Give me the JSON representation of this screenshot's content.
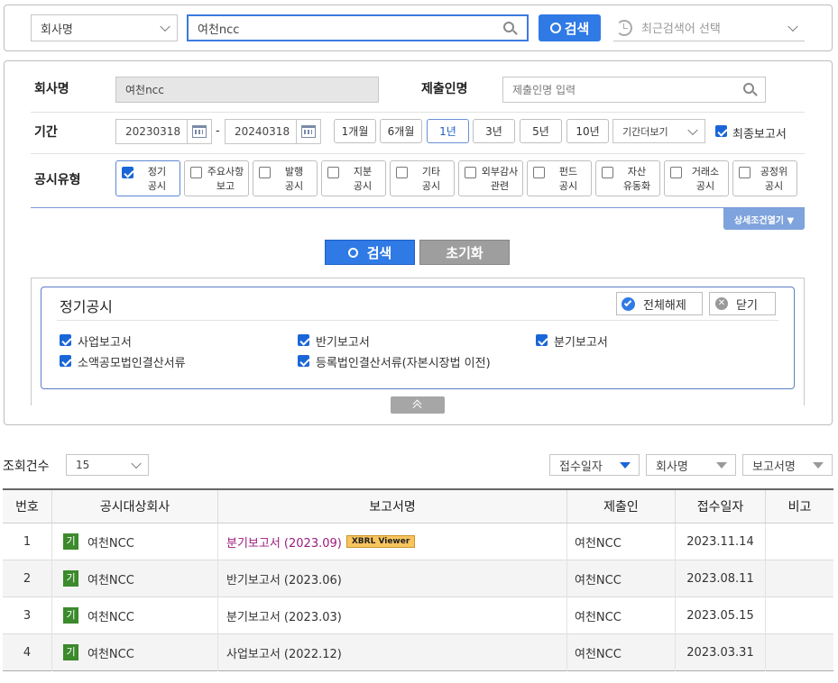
{
  "search": {
    "scope": "회사명",
    "query": "여천ncc",
    "button": "검색",
    "recent_placeholder": "최근검색어 선택"
  },
  "form": {
    "company_label": "회사명",
    "company_value": "여천ncc",
    "submitter_label": "제출인명",
    "submitter_placeholder": "제출인명 입력",
    "period_label": "기간",
    "date_from": "20230318",
    "date_sep": "-",
    "date_to": "20240318",
    "periods": [
      "1개월",
      "6개월",
      "1년",
      "3년",
      "5년",
      "10년"
    ],
    "period_more": "기간더보기",
    "final_report_label": "최종보고서",
    "type_label": "공시유형",
    "types": [
      {
        "line1": "정기",
        "line2": "공시",
        "checked": true
      },
      {
        "line1": "주요사항",
        "line2": "보고",
        "checked": false
      },
      {
        "line1": "발행",
        "line2": "공시",
        "checked": false
      },
      {
        "line1": "지분",
        "line2": "공시",
        "checked": false
      },
      {
        "line1": "기타",
        "line2": "공시",
        "checked": false
      },
      {
        "line1": "외부감사",
        "line2": "관련",
        "checked": false
      },
      {
        "line1": "펀드",
        "line2": "공시",
        "checked": false
      },
      {
        "line1": "자산",
        "line2": "유동화",
        "checked": false
      },
      {
        "line1": "거래소",
        "line2": "공시",
        "checked": false
      },
      {
        "line1": "공정위",
        "line2": "공시",
        "checked": false
      }
    ],
    "detail_toggle": "상세조건열기 ▼",
    "search_button": "검색",
    "reset_button": "초기화"
  },
  "periodic": {
    "title": "정기공시",
    "deselect_all": "전체해제",
    "close": "닫기",
    "items": [
      "사업보고서",
      "반기보고서",
      "분기보고서",
      "소액공모법인결산서류",
      "등록법인결산서류(자본시장법 이전)"
    ]
  },
  "results": {
    "count_label": "조회건수",
    "page_size": "15",
    "sort1": "접수일자",
    "sort2": "회사명",
    "sort3": "보고서명",
    "columns": [
      "번호",
      "공시대상회사",
      "보고서명",
      "제출인",
      "접수일자",
      "비고"
    ],
    "badge": "기",
    "xbrl": "XBRL Viewer",
    "rows": [
      {
        "no": "1",
        "company": "여천NCC",
        "report": "분기보고서 (2023.09)",
        "submitter": "여천NCC",
        "date": "2023.11.14"
      },
      {
        "no": "2",
        "company": "여천NCC",
        "report": "반기보고서 (2023.06)",
        "submitter": "여천NCC",
        "date": "2023.08.11"
      },
      {
        "no": "3",
        "company": "여천NCC",
        "report": "분기보고서 (2023.03)",
        "submitter": "여천NCC",
        "date": "2023.05.15"
      },
      {
        "no": "4",
        "company": "여천NCC",
        "report": "사업보고서 (2022.12)",
        "submitter": "여천NCC",
        "date": "2023.03.31"
      }
    ]
  },
  "colors": {
    "accent": "#2f7ae5",
    "badge_green": "#3b8a2c",
    "link_purple": "#9b1c7c",
    "xbrl_bg": "#f7c45e"
  }
}
